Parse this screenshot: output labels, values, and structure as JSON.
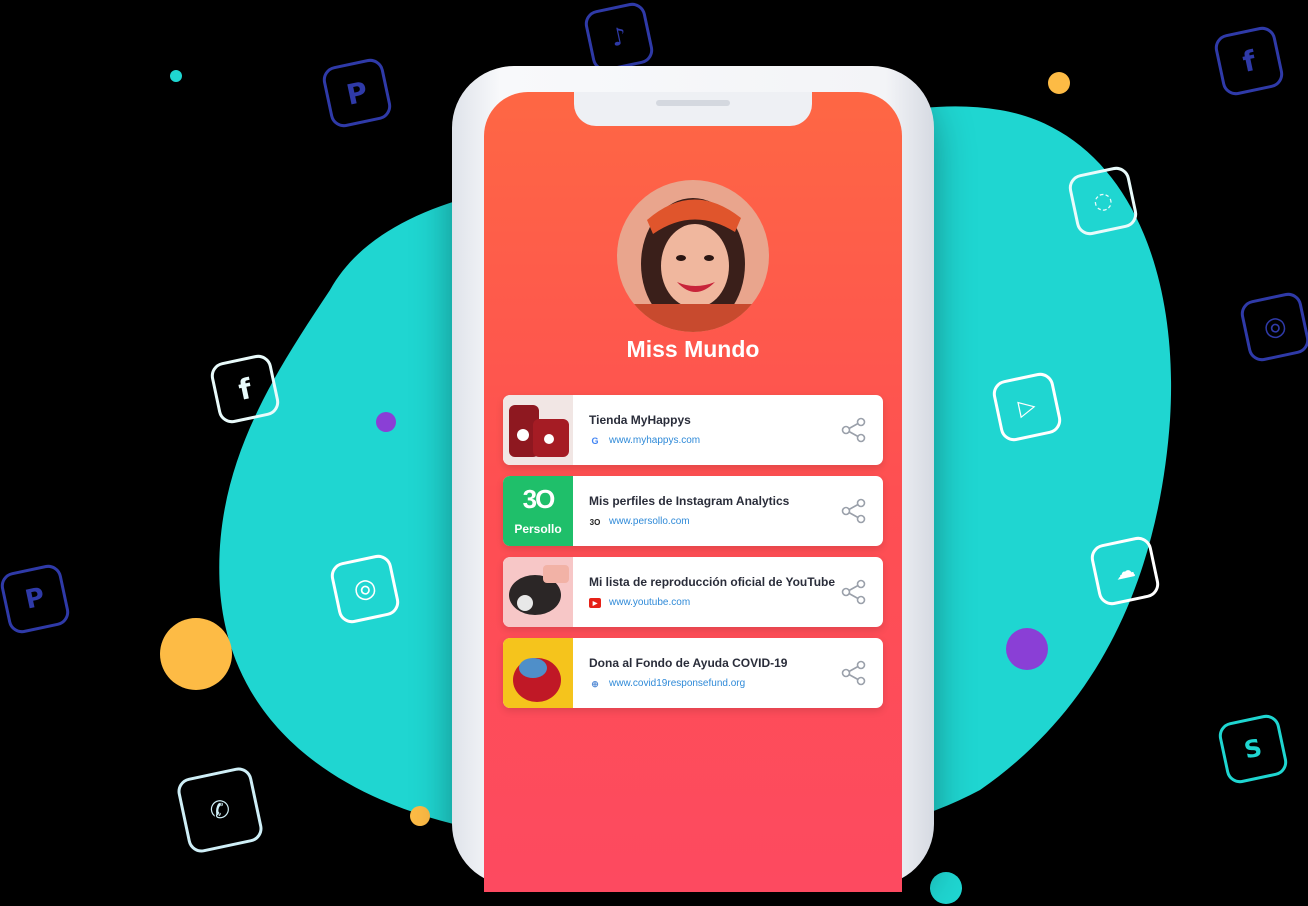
{
  "profile": {
    "name": "Miss Mundo"
  },
  "links": [
    {
      "title": "Tienda MyHappys",
      "url": "www.myhappys.com",
      "favicon": "google-icon"
    },
    {
      "title": "Mis perfiles de Instagram Analytics",
      "url": "www.persollo.com",
      "favicon": "persollo-icon",
      "thumb_text": "Persollo"
    },
    {
      "title": "Mi lista de reproducción oficial de YouTube",
      "url": "www.youtube.com",
      "favicon": "youtube-icon"
    },
    {
      "title": "Dona al Fondo de Ayuda COVID-19",
      "url": "www.covid19responsefund.org",
      "favicon": "un-globe-icon"
    }
  ],
  "colors": {
    "blob": "#1fd6d1",
    "screen_top": "#fe6744",
    "screen_bottom": "#fd4a60",
    "url": "#2f8ad8",
    "persollo_green": "#1fbf6a"
  }
}
